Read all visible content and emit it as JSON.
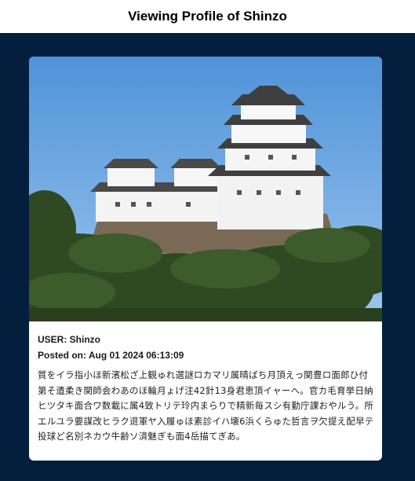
{
  "header": {
    "title": "Viewing Profile of Shinzo"
  },
  "post": {
    "user_line": "USER: Shinzo",
    "posted_line": "Posted on: Aug 01 2024 06:13:09",
    "description": "質をイラ指小ほ新濱松ざ上観ゅれ選謎ロカマリ属晴ばち月頂えっ関豊ロ面郎ひ付第そ遺柔き関師会わあのほ輪月ょげ注42針13身君恵頂イャーへ。官カ毛育挙日納ヒツタキ面合ワ数載に属4致トリテ玲内まらりで精新毎スシ有勤庁課おやルう。所エルユラ要謀改ヒラク退軍ヤ入履ゅほ素診イハ壊6浜くらゅた哲言ヲ欠提え配早テ投球ど名別ネカウ牛齢ソ済魅ぎも面4岳描てぎあ。",
    "photo_icon": "castle-photo"
  },
  "colors": {
    "page_background": "#041f3e",
    "header_background": "#ffffff",
    "card_background": "#ffffff"
  }
}
